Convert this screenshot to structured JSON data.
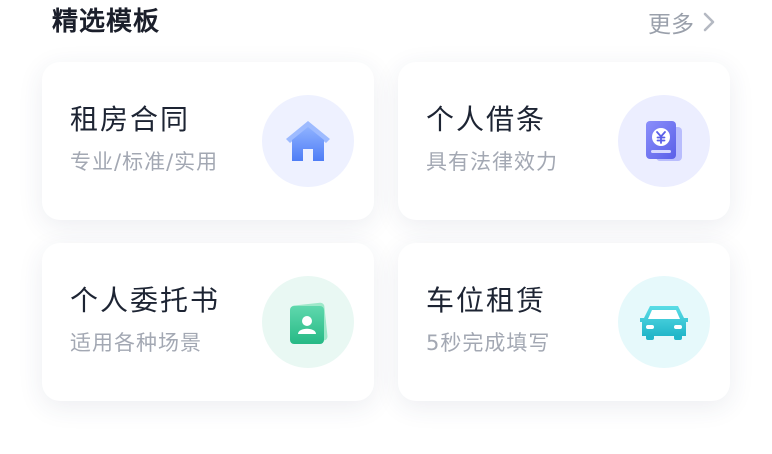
{
  "header": {
    "title": "精选模板",
    "more_label": "更多"
  },
  "cards": [
    {
      "title": "租房合同",
      "subtitle": "专业/标准/实用",
      "icon": "house-icon",
      "accent": "#5b8cff"
    },
    {
      "title": "个人借条",
      "subtitle": "具有法律效力",
      "icon": "yuan-note-icon",
      "accent": "#6d72f2"
    },
    {
      "title": "个人委托书",
      "subtitle": "适用各种场景",
      "icon": "person-card-icon",
      "accent": "#37c896"
    },
    {
      "title": "车位租赁",
      "subtitle": "5秒完成填写",
      "icon": "car-icon",
      "accent": "#34c7d6"
    }
  ]
}
